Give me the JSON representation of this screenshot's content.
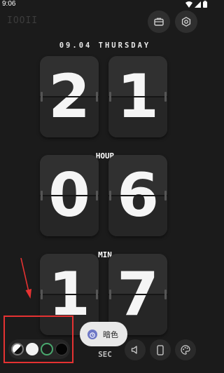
{
  "status_bar": {
    "time": "9:06",
    "icons": [
      "wifi-icon",
      "signal-icon",
      "battery-icon"
    ]
  },
  "app": {
    "title": "IOOII"
  },
  "header": {
    "date": "09.04 THURSDAY",
    "buttons": [
      "wallet-icon",
      "settings-icon"
    ]
  },
  "clock": {
    "hour": {
      "label": "HOUR",
      "digits": [
        "2",
        "1"
      ]
    },
    "minute": {
      "label": "MIN",
      "digits": [
        "0",
        "6"
      ]
    },
    "second": {
      "label": "SEC",
      "digits": [
        "1",
        "7"
      ]
    }
  },
  "theme_picker": {
    "swatches": [
      "auto-theme",
      "light-theme",
      "green-theme",
      "dark-theme"
    ],
    "selected": "green-theme"
  },
  "toast": {
    "text": "暗色"
  },
  "bottom_bar": {
    "buttons": [
      "sound-icon",
      "phone-icon",
      "palette-icon"
    ]
  },
  "colors": {
    "background": "#1b1b1b",
    "card": "#2c2c2c",
    "accent": "#49a86e",
    "annotation": "#e53232"
  }
}
